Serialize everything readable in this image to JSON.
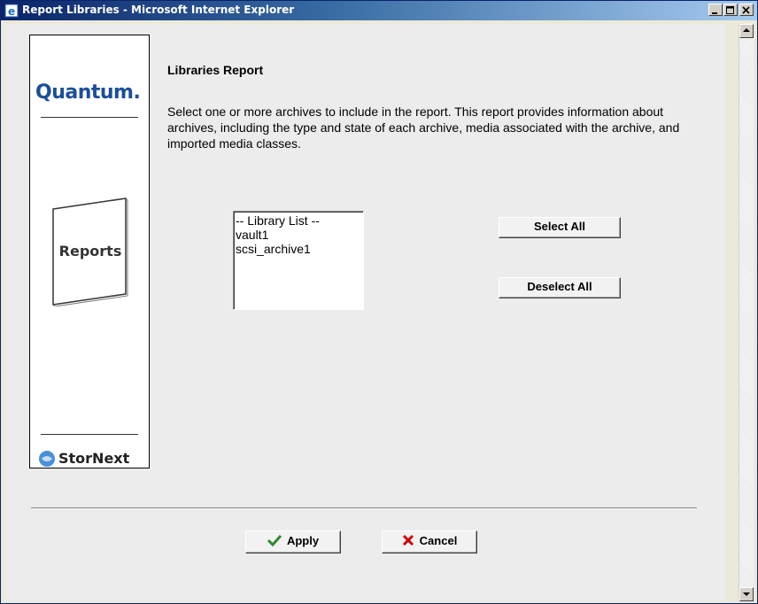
{
  "window": {
    "title": "Report Libraries - Microsoft Internet Explorer"
  },
  "sidebar": {
    "brand_logo": "Quantum.",
    "section_label": "Reports",
    "product_logo": "StorNext"
  },
  "main": {
    "title": "Libraries Report",
    "description": "Select one or more archives to include in the report. This report provides information about archives, including the type and state of each archive, media associated with the archive, and imported media classes.",
    "library_list": {
      "items": [
        "-- Library List --",
        "vault1",
        "scsi_archive1"
      ]
    },
    "select_all_label": "Select All",
    "deselect_all_label": "Deselect All"
  },
  "footer": {
    "apply_label": "Apply",
    "cancel_label": "Cancel"
  },
  "colors": {
    "titlebar_start": "#0a246a",
    "titlebar_end": "#a6caf0",
    "brand_blue": "#1b4e9b",
    "apply_check": "#2e8b2e",
    "cancel_x": "#cc0000"
  }
}
